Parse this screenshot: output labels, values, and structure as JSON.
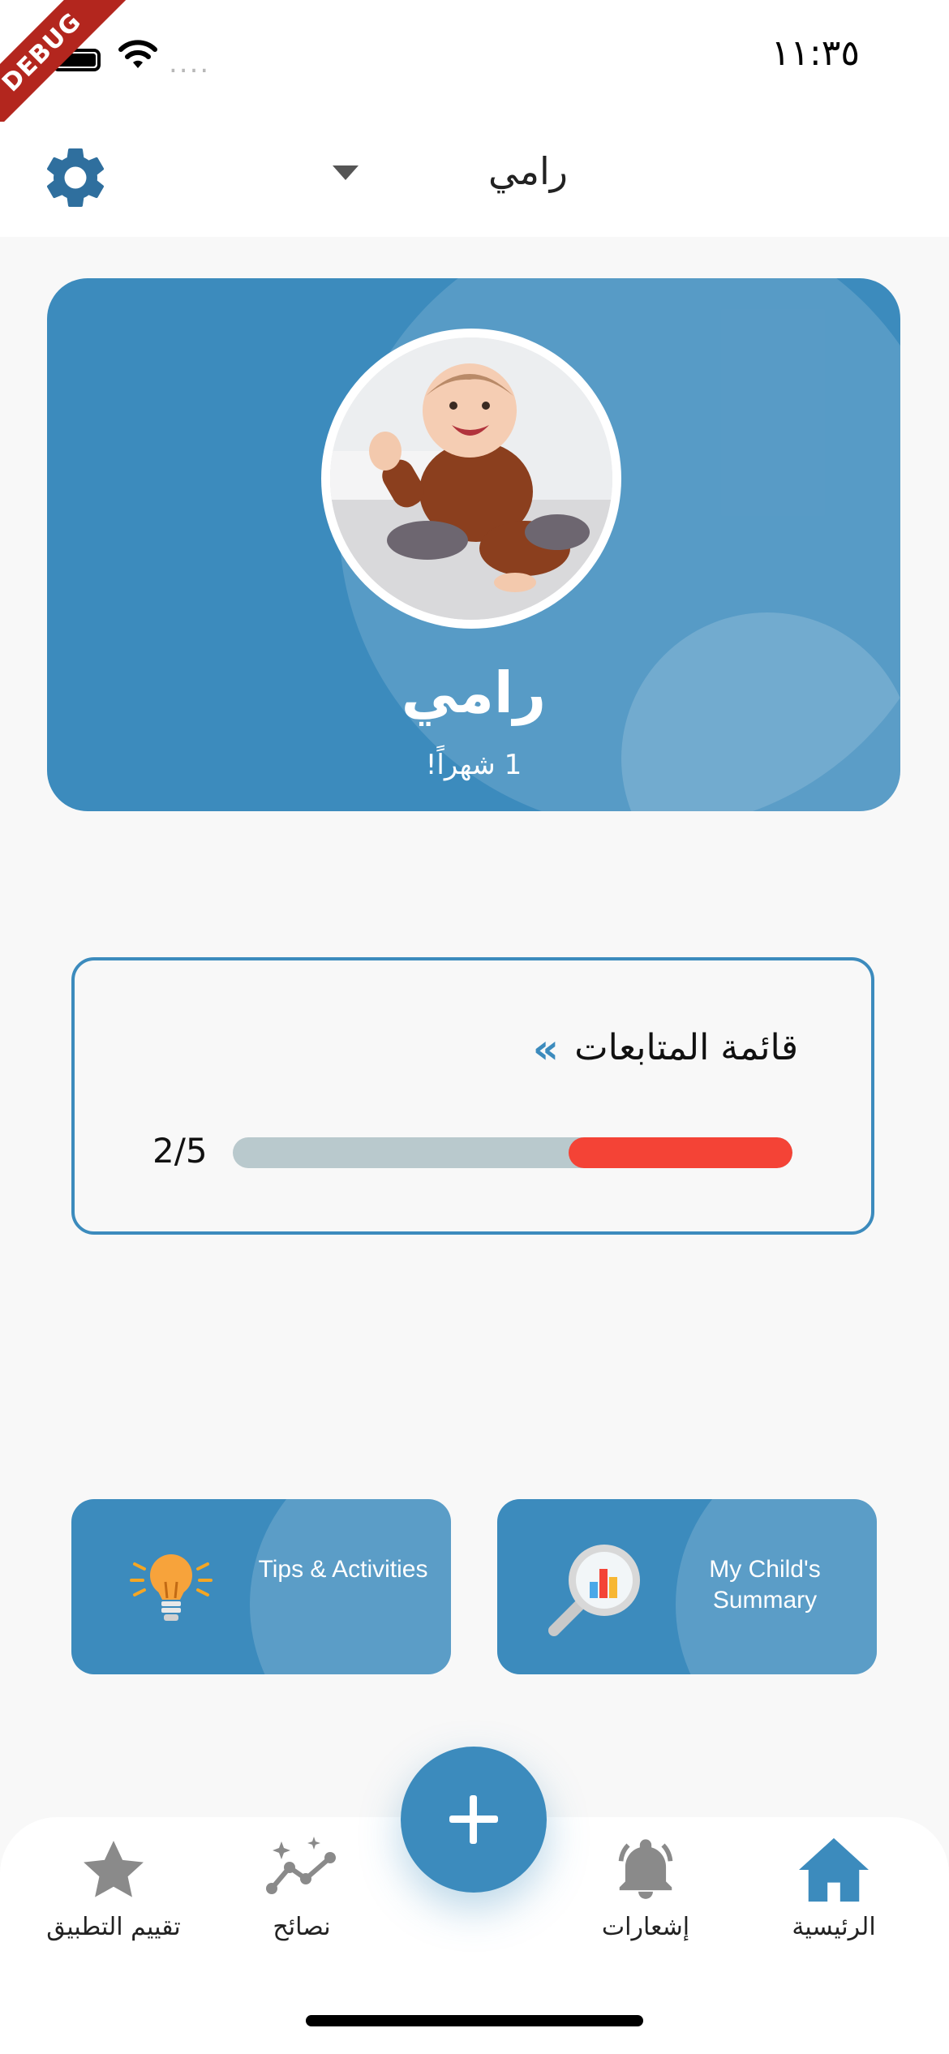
{
  "status_bar": {
    "time": "١١:٣٥",
    "debug_label": "DEBUG",
    "signal_dots": "....",
    "icons": [
      "battery-icon",
      "wifi-icon"
    ]
  },
  "app_bar": {
    "settings_icon": "gear-icon",
    "selected_child": "رامي",
    "dropdown_icon": "caret-down-icon"
  },
  "profile": {
    "name": "رامي",
    "age": "1 شهراً!",
    "photo": "baby-photo"
  },
  "followup": {
    "title": "قائمة المتابعات",
    "arrow": "«",
    "progress_text": "2/5",
    "progress_fraction": 0.4
  },
  "features": {
    "tips_label": "Tips & Activities",
    "tips_icon": "lightbulb-icon",
    "summary_label": "My Child's Summary",
    "summary_icon": "magnifier-chart-icon"
  },
  "bottom_nav": {
    "items": [
      {
        "label": "تقييم التطبيق",
        "icon": "star-icon"
      },
      {
        "label": "نصائح",
        "icon": "sparkle-trend-icon"
      },
      {
        "label": "إشعارات",
        "icon": "bell-icon"
      },
      {
        "label": "الرئيسية",
        "icon": "home-icon"
      }
    ],
    "fab_icon": "plus-icon"
  },
  "colors": {
    "primary": "#3c8bbd",
    "progress_fill": "#f44336",
    "progress_track": "#b9c9cd",
    "background": "#f8f8f8"
  }
}
